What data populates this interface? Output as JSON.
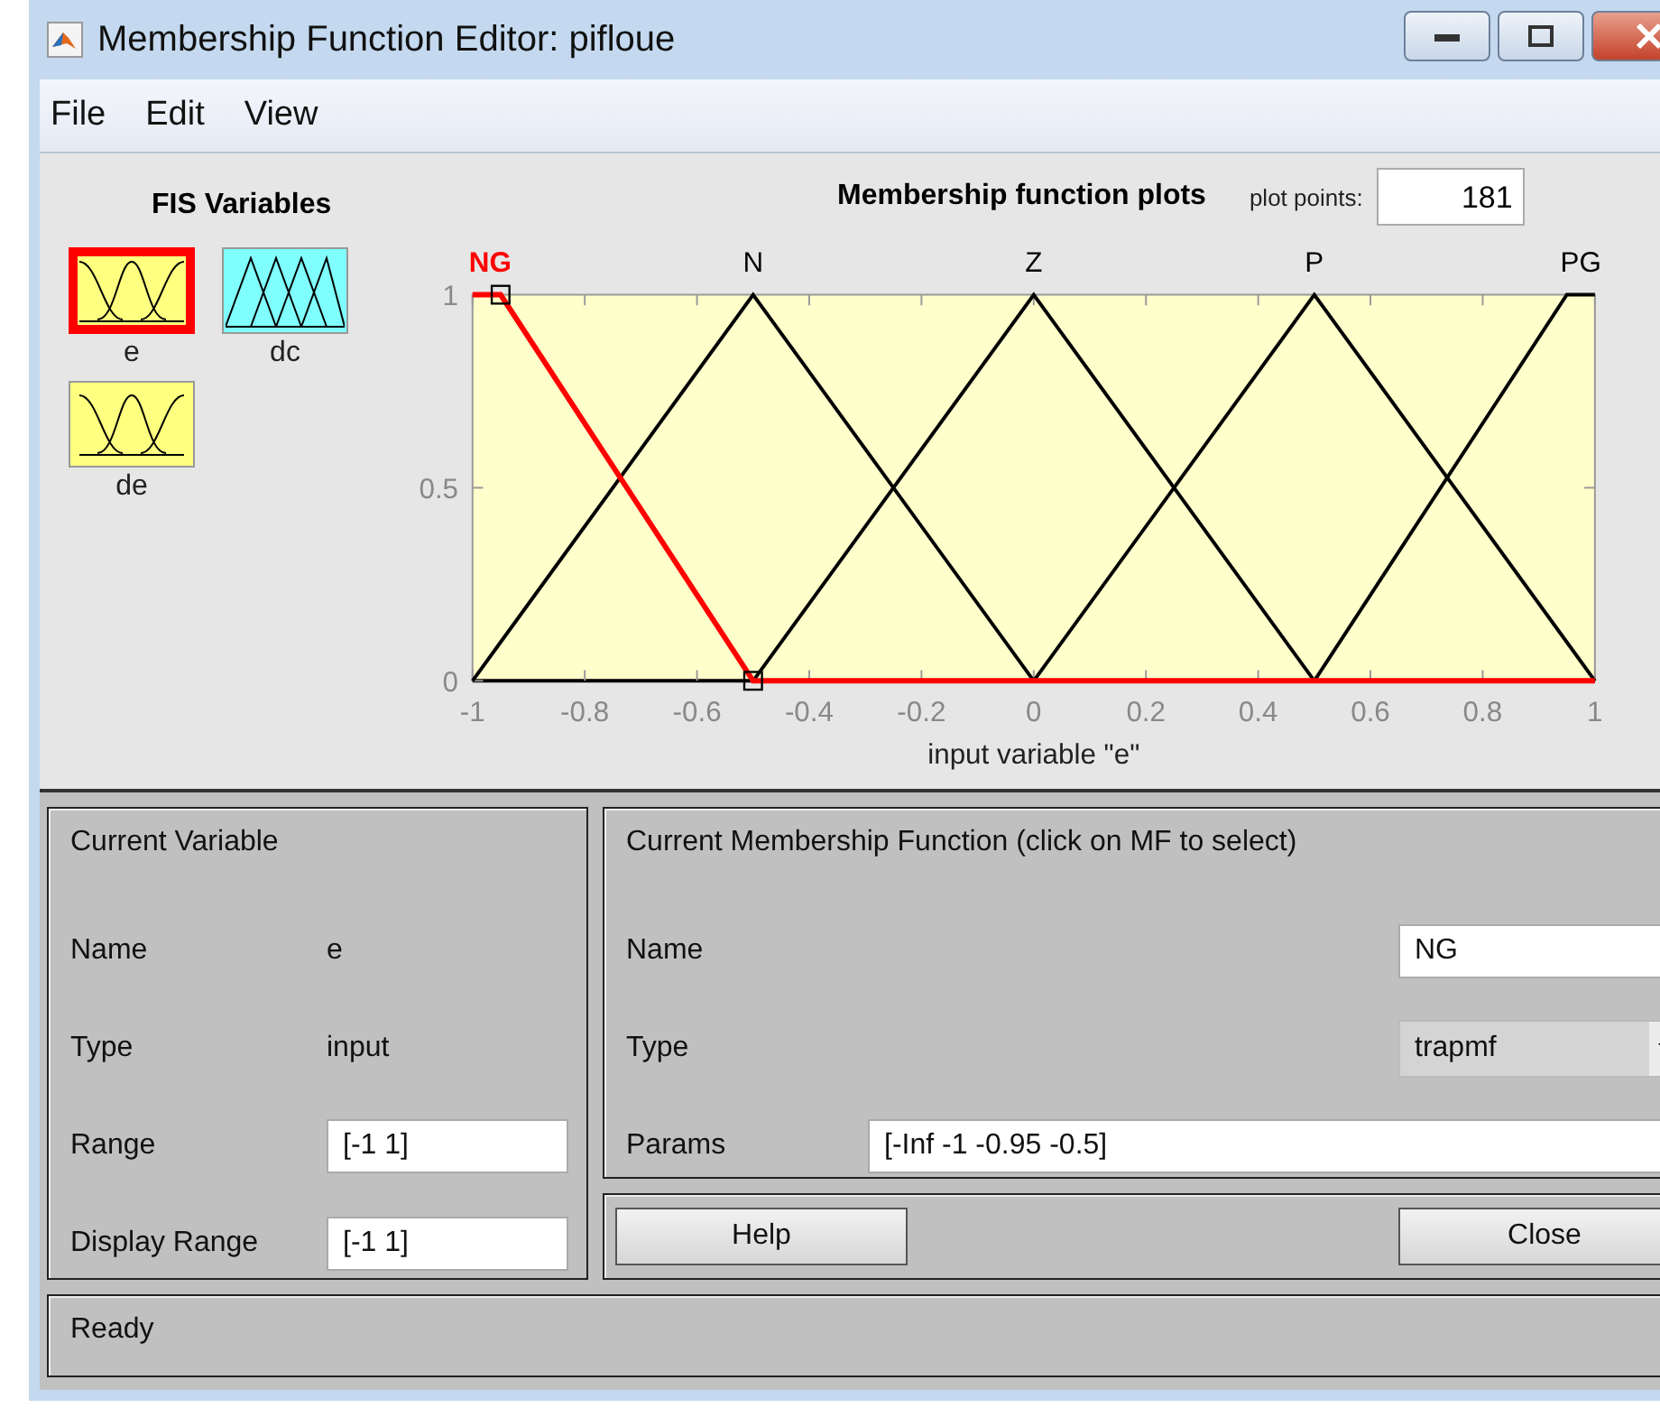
{
  "window": {
    "title": "Membership Function Editor: pifloue"
  },
  "menu": [
    "File",
    "Edit",
    "View"
  ],
  "fis_variables": {
    "title": "FIS Variables",
    "items": [
      {
        "label": "e",
        "kind": "input",
        "selected": true
      },
      {
        "label": "dc",
        "kind": "output",
        "selected": false
      },
      {
        "label": "de",
        "kind": "input",
        "selected": false
      }
    ]
  },
  "plot": {
    "plot_points_label": "plot points:",
    "plot_points": "181",
    "chart_data": {
      "type": "line",
      "title": "Membership function plots",
      "xlabel": "input variable \"e\"",
      "x": [
        -1,
        -0.95,
        -0.5,
        0,
        0.5,
        0.95,
        1
      ],
      "series": [
        {
          "name": "NG",
          "color": "#ff0000",
          "values": [
            1,
            1,
            0,
            0,
            0,
            0,
            0
          ]
        },
        {
          "name": "N",
          "color": "#000000",
          "values": [
            0,
            0.1,
            1,
            0,
            null,
            null,
            null
          ]
        },
        {
          "name": "Z",
          "color": "#000000",
          "values": [
            null,
            null,
            0,
            1,
            0,
            null,
            null
          ]
        },
        {
          "name": "P",
          "color": "#000000",
          "values": [
            null,
            null,
            null,
            0,
            1,
            0.1,
            0
          ]
        },
        {
          "name": "PG",
          "color": "#000000",
          "values": [
            null,
            null,
            null,
            null,
            0,
            1,
            1
          ]
        }
      ],
      "xlim": [
        -1,
        1
      ],
      "ylim": [
        0,
        1
      ],
      "xticks": [
        -1,
        -0.8,
        -0.6,
        -0.4,
        -0.2,
        0,
        0.2,
        0.4,
        0.6,
        0.8,
        1
      ],
      "yticks": [
        0,
        0.5,
        1
      ]
    }
  },
  "current_variable": {
    "title": "Current Variable",
    "name_label": "Name",
    "name": "e",
    "type_label": "Type",
    "type": "input",
    "range_label": "Range",
    "range": "[-1 1]",
    "display_range_label": "Display Range",
    "display_range": "[-1 1]"
  },
  "current_mf": {
    "title": "Current Membership Function (click on MF to select)",
    "name_label": "Name",
    "name": "NG",
    "type_label": "Type",
    "type": "trapmf",
    "params_label": "Params",
    "params": "[-Inf -1 -0.95 -0.5]"
  },
  "buttons": [
    "Help",
    "Close"
  ],
  "status_bar": "Ready"
}
